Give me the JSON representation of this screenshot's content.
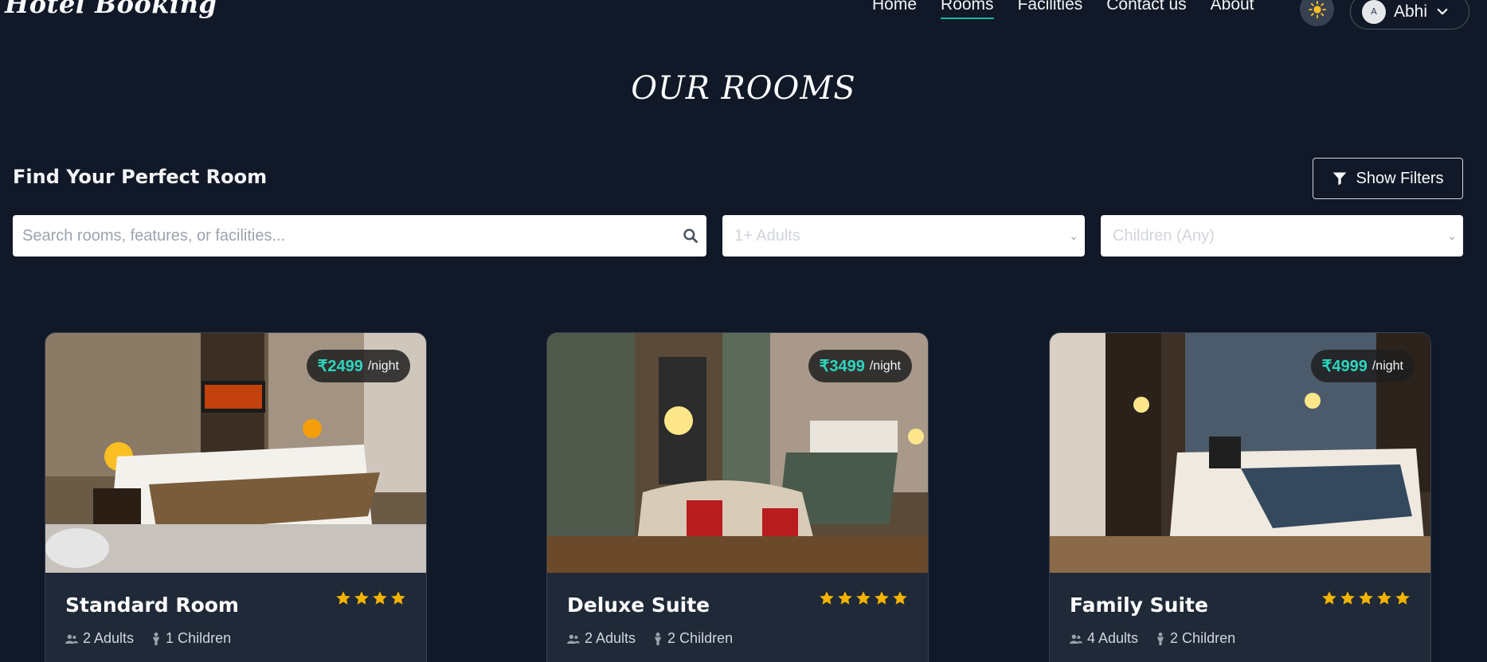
{
  "header": {
    "brand": "Hotel Booking",
    "nav": [
      {
        "label": "Home",
        "active": false
      },
      {
        "label": "Rooms",
        "active": true
      },
      {
        "label": "Facilities",
        "active": false
      },
      {
        "label": "Contact us",
        "active": false
      },
      {
        "label": "About",
        "active": false
      }
    ],
    "theme_icon": "sun-icon",
    "user": {
      "name": "Abhi",
      "avatar_alt": "A"
    }
  },
  "page_title": "OUR ROOMS",
  "finder": {
    "title": "Find Your Perfect Room",
    "filter_button": "Show Filters",
    "search_placeholder": "Search rooms, features, or facilities...",
    "adults_select": "1+ Adults",
    "children_select": "Children (Any)"
  },
  "colors": {
    "accent": "#14b8a6",
    "price": "#2dd4bf",
    "star": "#f5b301",
    "background": "#111827",
    "card": "#1f2937"
  },
  "rooms": [
    {
      "name": "Standard Room",
      "price": "₹2499",
      "unit": "/night",
      "stars": 4,
      "adults": "2 Adults",
      "children": "1 Children"
    },
    {
      "name": "Deluxe Suite",
      "price": "₹3499",
      "unit": "/night",
      "stars": 5,
      "adults": "2 Adults",
      "children": "2 Children"
    },
    {
      "name": "Family Suite",
      "price": "₹4999",
      "unit": "/night",
      "stars": 5,
      "adults": "4 Adults",
      "children": "2 Children"
    }
  ]
}
